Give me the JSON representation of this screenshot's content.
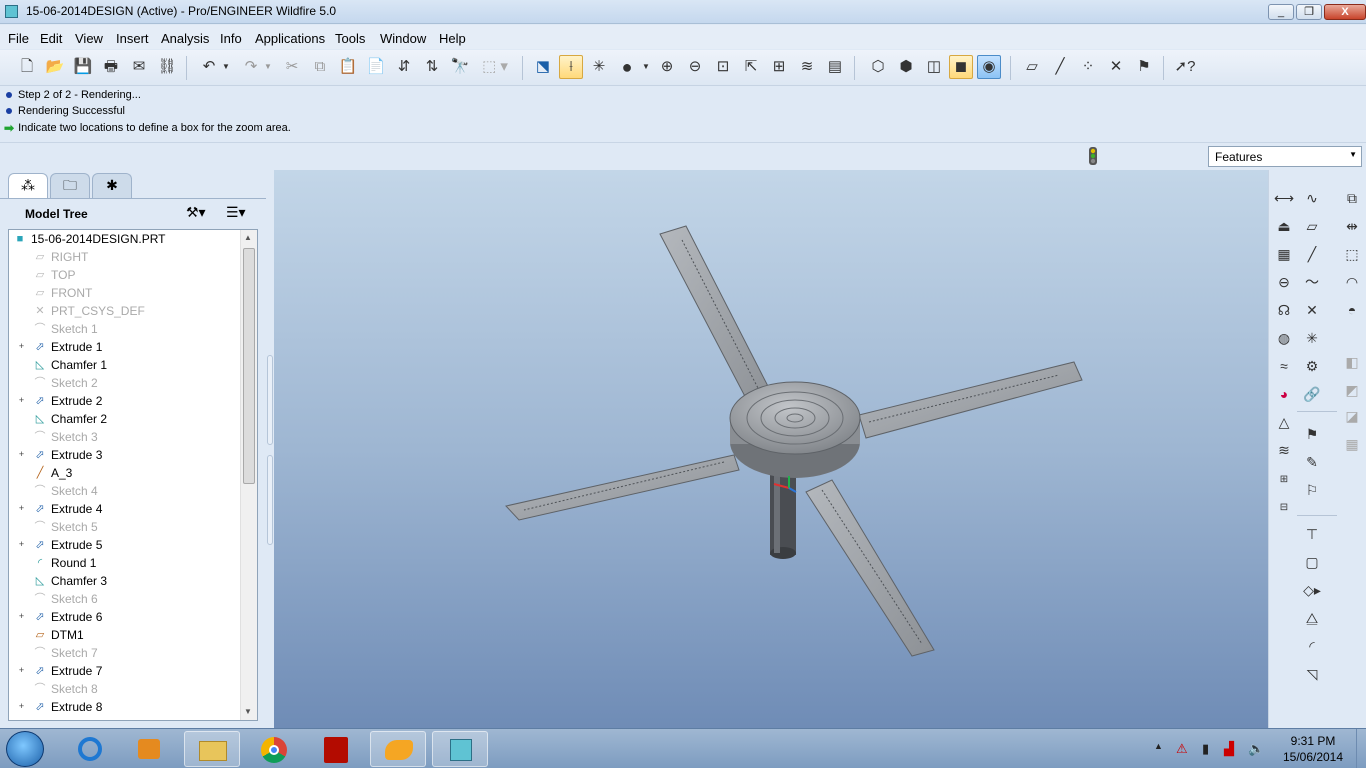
{
  "window": {
    "title": "15-06-2014DESIGN (Active) - Pro/ENGINEER Wildfire 5.0",
    "minimize": "_",
    "maximize": "❐",
    "close": "X"
  },
  "menu": [
    "File",
    "Edit",
    "View",
    "Insert",
    "Analysis",
    "Info",
    "Applications",
    "Tools",
    "Window",
    "Help"
  ],
  "messages": {
    "line1": "Step 2 of 2 - Rendering...",
    "line2": "Rendering Successful",
    "line3": "Indicate two locations to define a box for the zoom area."
  },
  "filter": {
    "selected": "Features"
  },
  "model_tree": {
    "title": "Model Tree",
    "root": "15-06-2014DESIGN.PRT",
    "items": [
      {
        "label": "RIGHT",
        "icon": "datum-plane-icon",
        "dim": true,
        "expandable": false
      },
      {
        "label": "TOP",
        "icon": "datum-plane-icon",
        "dim": true,
        "expandable": false
      },
      {
        "label": "FRONT",
        "icon": "datum-plane-icon",
        "dim": true,
        "expandable": false
      },
      {
        "label": "PRT_CSYS_DEF",
        "icon": "csys-icon",
        "dim": true,
        "expandable": false
      },
      {
        "label": "Sketch 1",
        "icon": "sketch-icon",
        "dim": true,
        "expandable": false
      },
      {
        "label": "Extrude 1",
        "icon": "extrude-icon",
        "dim": false,
        "expandable": true
      },
      {
        "label": "Chamfer 1",
        "icon": "chamfer-icon",
        "dim": false,
        "expandable": false
      },
      {
        "label": "Sketch 2",
        "icon": "sketch-icon",
        "dim": true,
        "expandable": false
      },
      {
        "label": "Extrude 2",
        "icon": "extrude-icon",
        "dim": false,
        "expandable": true
      },
      {
        "label": "Chamfer 2",
        "icon": "chamfer-icon",
        "dim": false,
        "expandable": false
      },
      {
        "label": "Sketch 3",
        "icon": "sketch-icon",
        "dim": true,
        "expandable": false
      },
      {
        "label": "Extrude 3",
        "icon": "extrude-icon",
        "dim": false,
        "expandable": true
      },
      {
        "label": "A_3",
        "icon": "axis-icon",
        "dim": false,
        "expandable": false
      },
      {
        "label": "Sketch 4",
        "icon": "sketch-icon",
        "dim": true,
        "expandable": false
      },
      {
        "label": "Extrude 4",
        "icon": "extrude-icon",
        "dim": false,
        "expandable": true
      },
      {
        "label": "Sketch 5",
        "icon": "sketch-icon",
        "dim": true,
        "expandable": false
      },
      {
        "label": "Extrude 5",
        "icon": "extrude-icon",
        "dim": false,
        "expandable": true
      },
      {
        "label": "Round 1",
        "icon": "round-icon",
        "dim": false,
        "expandable": false
      },
      {
        "label": "Chamfer 3",
        "icon": "chamfer-icon",
        "dim": false,
        "expandable": false
      },
      {
        "label": "Sketch 6",
        "icon": "sketch-icon",
        "dim": true,
        "expandable": false
      },
      {
        "label": "Extrude 6",
        "icon": "extrude-icon",
        "dim": false,
        "expandable": true
      },
      {
        "label": "DTM1",
        "icon": "datum-plane-icon",
        "dim": false,
        "expandable": false
      },
      {
        "label": "Sketch 7",
        "icon": "sketch-icon",
        "dim": true,
        "expandable": false
      },
      {
        "label": "Extrude 7",
        "icon": "extrude-icon",
        "dim": false,
        "expandable": true
      },
      {
        "label": "Sketch 8",
        "icon": "sketch-icon",
        "dim": true,
        "expandable": false
      },
      {
        "label": "Extrude 8",
        "icon": "extrude-icon",
        "dim": false,
        "expandable": true
      }
    ]
  },
  "taskbar": {
    "time": "9:31 PM",
    "date": "15/06/2014",
    "apps": [
      "internet-explorer-icon",
      "media-player-icon",
      "file-explorer-icon",
      "chrome-icon",
      "acrobat-icon",
      "paint-app-icon",
      "proe-icon"
    ]
  },
  "colors": {
    "graphics_top": "#c3d6e8",
    "graphics_bottom": "#6f8cb6",
    "model_gray": "#9a9ea3",
    "accent_yellow": "#ffd97a"
  }
}
